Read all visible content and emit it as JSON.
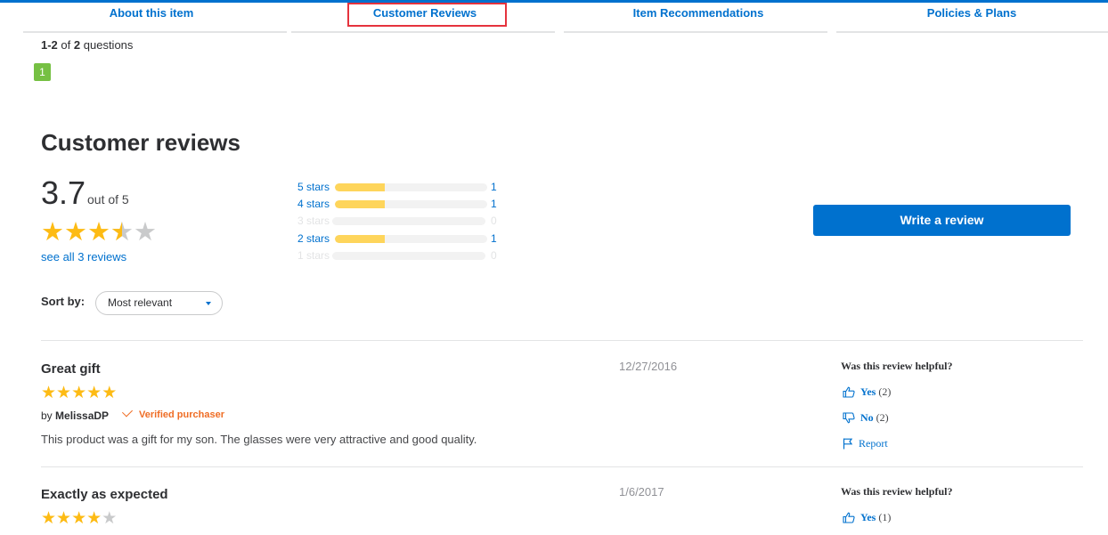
{
  "nav": {
    "tabs": [
      {
        "label": "About this item"
      },
      {
        "label": "Customer Reviews"
      },
      {
        "label": "Item Recommendations"
      },
      {
        "label": "Policies & Plans"
      }
    ]
  },
  "questions": {
    "range": "1-2",
    "of_word": "of",
    "total": "2",
    "unit": "questions",
    "current_page": "1"
  },
  "reviews_summary": {
    "heading": "Customer reviews",
    "average": "3.7",
    "out_of": "out of 5",
    "rating_value": 3.7,
    "rating_max": 5,
    "see_all": "see all 3 reviews",
    "histogram": [
      {
        "label": "5 stars",
        "count": "1",
        "fraction": 0.33
      },
      {
        "label": "4 stars",
        "count": "1",
        "fraction": 0.33
      },
      {
        "label": "3 stars",
        "count": "0",
        "fraction": 0
      },
      {
        "label": "2 stars",
        "count": "1",
        "fraction": 0.33
      },
      {
        "label": "1 stars",
        "count": "0",
        "fraction": 0
      }
    ],
    "write_review": "Write a review"
  },
  "sort": {
    "label": "Sort by:",
    "selected": "Most relevant"
  },
  "reviews": [
    {
      "title": "Great gift",
      "rating": 5,
      "by": "by",
      "author": "MelissaDP",
      "verified": "Verified purchaser",
      "body": "This product was a gift for my son. The glasses were very attractive and good quality.",
      "date": "12/27/2016",
      "helpful_question": "Was this review helpful?",
      "yes_label": "Yes",
      "yes_count": "(2)",
      "no_label": "No",
      "no_count": "(2)",
      "report_label": "Report"
    },
    {
      "title": "Exactly as expected",
      "rating": 4,
      "date": "1/6/2017",
      "helpful_question": "Was this review helpful?",
      "yes_label": "Yes",
      "yes_count": "(1)"
    }
  ],
  "colors": {
    "accent": "#0071ce",
    "star_on": "#fdbb14",
    "star_off": "#c9cacb",
    "verified": "#ef6d25",
    "bar_fill": "#fed55b",
    "page_pill": "#76c043",
    "highlight_box": "#e5333d"
  },
  "icons": {
    "thumbs_up": "thumbs-up-icon",
    "thumbs_down": "thumbs-down-icon",
    "flag": "flag-icon",
    "check": "check-icon",
    "caret": "caret-down-icon"
  }
}
